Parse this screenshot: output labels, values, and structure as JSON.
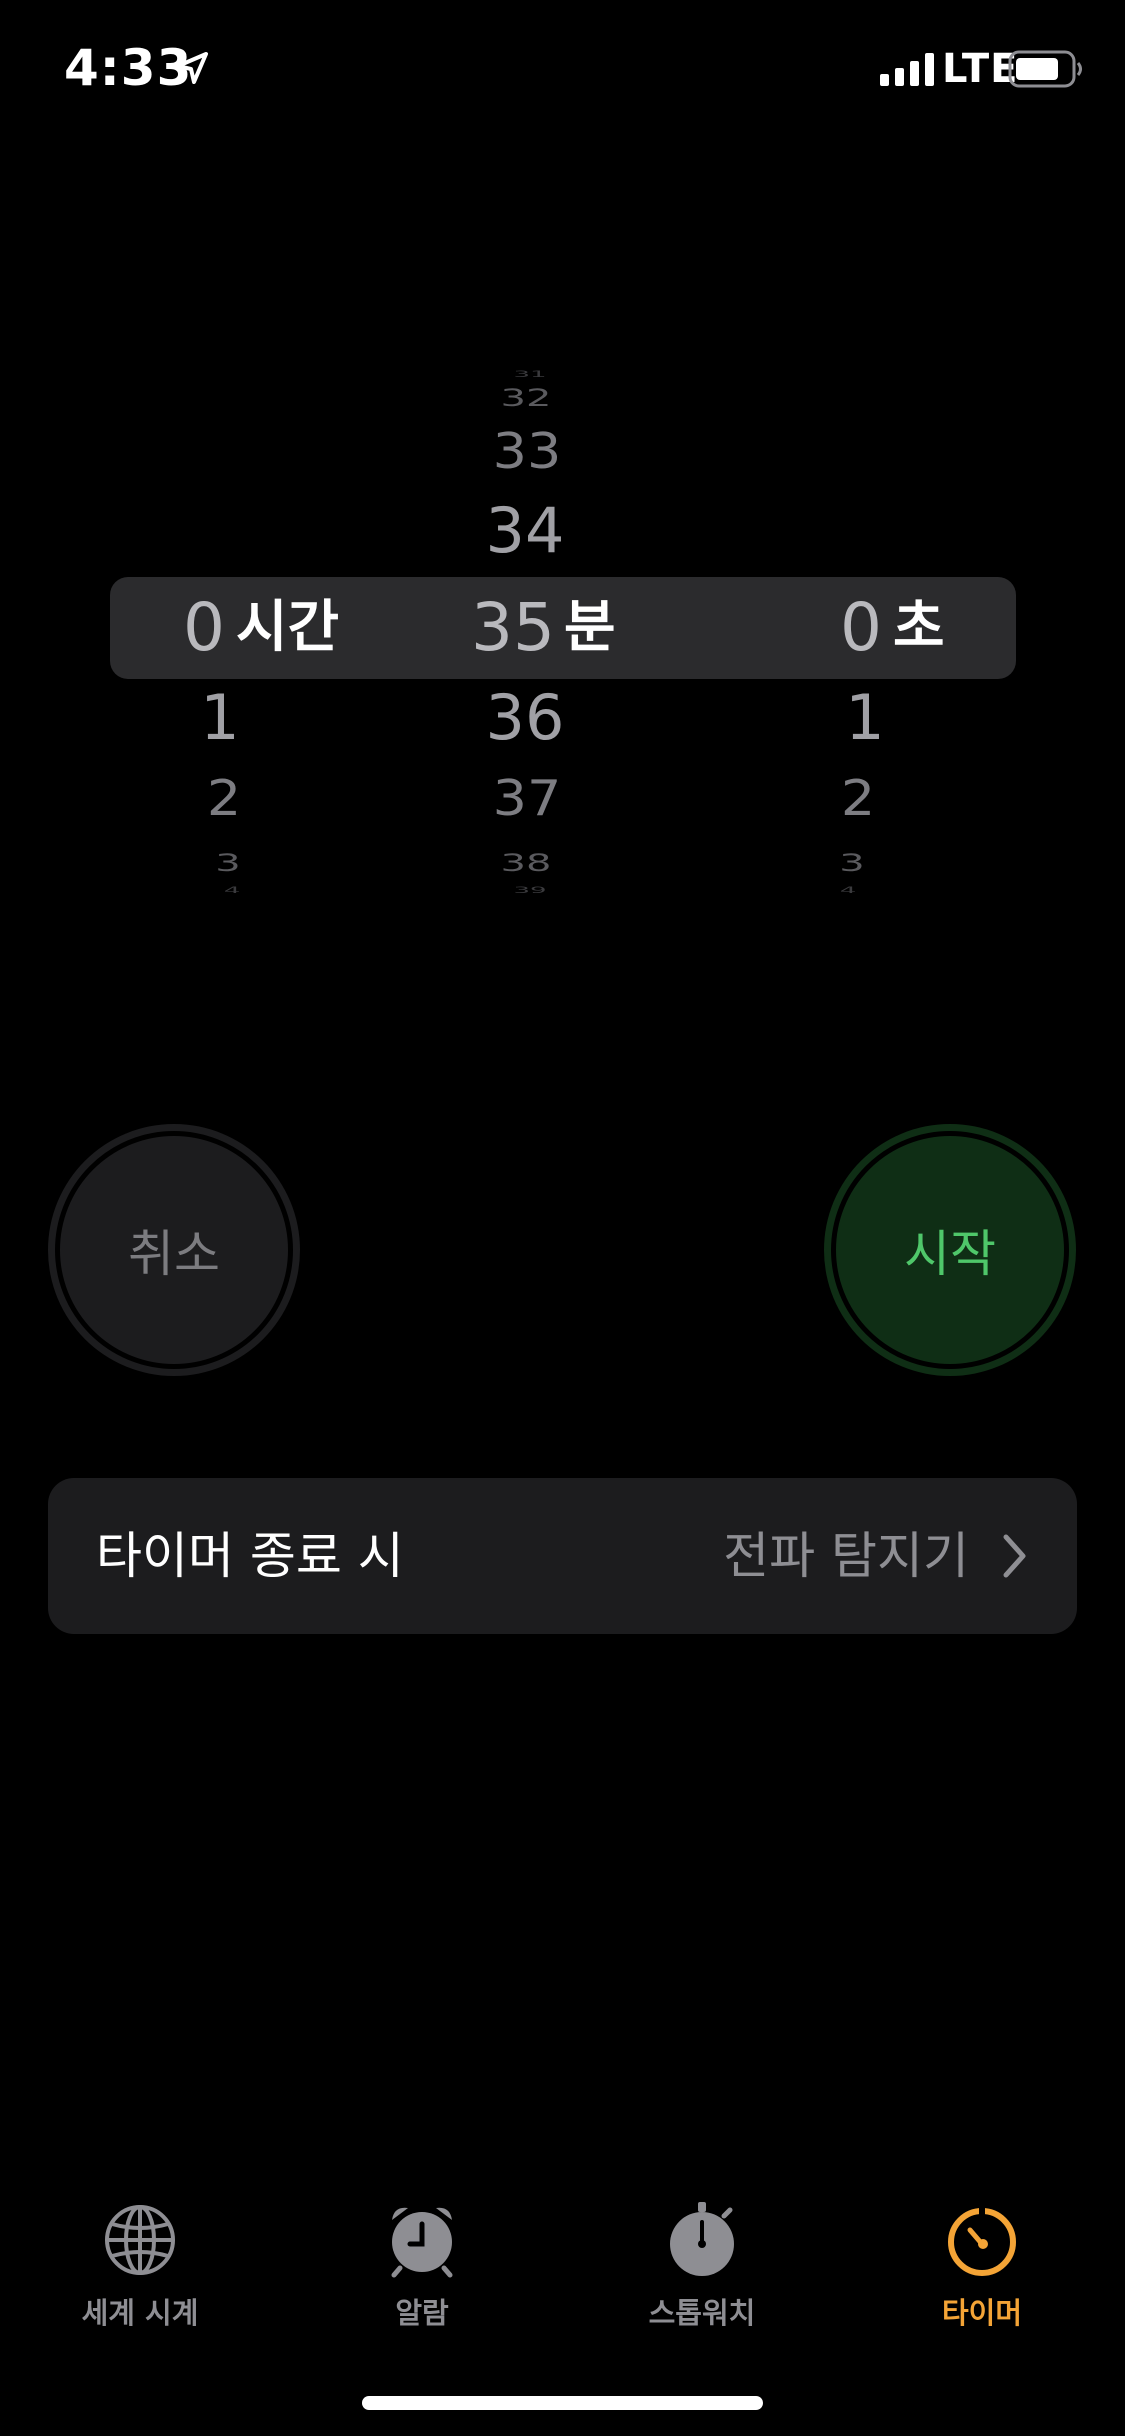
{
  "status_bar": {
    "time": "4:33",
    "network": "LTE",
    "location_icon": "location-arrow-icon",
    "signal_icon": "cellular-signal-icon",
    "battery_icon": "battery-icon"
  },
  "picker": {
    "hours": {
      "above": [],
      "selected": "0",
      "below": [
        "1",
        "2",
        "3",
        "4"
      ],
      "unit": "시간"
    },
    "minutes": {
      "above": [
        "31",
        "32",
        "33",
        "34"
      ],
      "selected": "35",
      "below": [
        "36",
        "37",
        "38",
        "39"
      ],
      "unit": "분"
    },
    "seconds": {
      "above": [],
      "selected": "0",
      "below": [
        "1",
        "2",
        "3",
        "4"
      ],
      "unit": "초"
    }
  },
  "buttons": {
    "cancel_label": "취소",
    "start_label": "시작"
  },
  "when_timer_ends": {
    "label": "타이머 종료 시",
    "value": "전파 탐지기"
  },
  "tab_bar": {
    "active_color": "#f4a436",
    "items": [
      {
        "label": "세계 시계",
        "icon": "globe-icon",
        "active": false
      },
      {
        "label": "알람",
        "icon": "alarm-clock-icon",
        "active": false
      },
      {
        "label": "스톱워치",
        "icon": "stopwatch-icon",
        "active": false
      },
      {
        "label": "타이머",
        "icon": "timer-icon",
        "active": true
      }
    ]
  }
}
